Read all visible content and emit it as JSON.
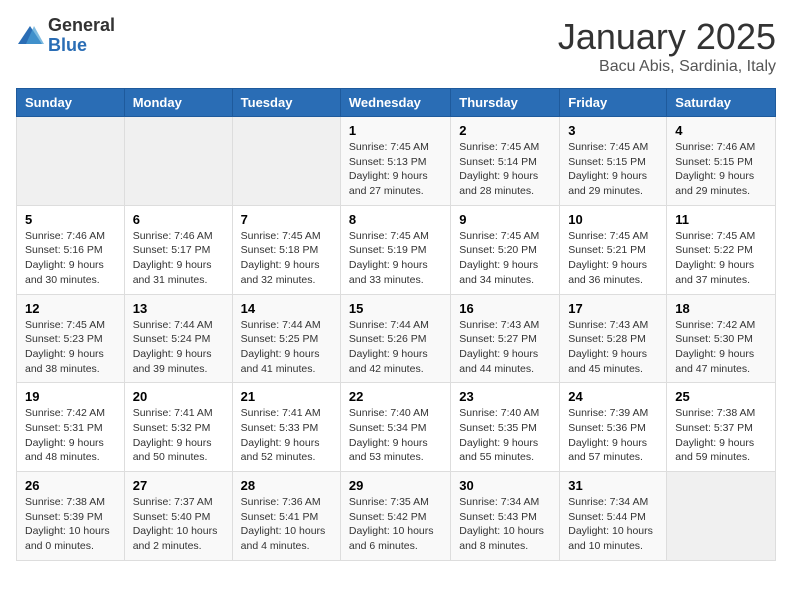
{
  "logo": {
    "general": "General",
    "blue": "Blue"
  },
  "title": "January 2025",
  "location": "Bacu Abis, Sardinia, Italy",
  "days_of_week": [
    "Sunday",
    "Monday",
    "Tuesday",
    "Wednesday",
    "Thursday",
    "Friday",
    "Saturday"
  ],
  "weeks": [
    [
      {
        "day": "",
        "detail": ""
      },
      {
        "day": "",
        "detail": ""
      },
      {
        "day": "",
        "detail": ""
      },
      {
        "day": "1",
        "detail": "Sunrise: 7:45 AM\nSunset: 5:13 PM\nDaylight: 9 hours and 27 minutes."
      },
      {
        "day": "2",
        "detail": "Sunrise: 7:45 AM\nSunset: 5:14 PM\nDaylight: 9 hours and 28 minutes."
      },
      {
        "day": "3",
        "detail": "Sunrise: 7:45 AM\nSunset: 5:15 PM\nDaylight: 9 hours and 29 minutes."
      },
      {
        "day": "4",
        "detail": "Sunrise: 7:46 AM\nSunset: 5:15 PM\nDaylight: 9 hours and 29 minutes."
      }
    ],
    [
      {
        "day": "5",
        "detail": "Sunrise: 7:46 AM\nSunset: 5:16 PM\nDaylight: 9 hours and 30 minutes."
      },
      {
        "day": "6",
        "detail": "Sunrise: 7:46 AM\nSunset: 5:17 PM\nDaylight: 9 hours and 31 minutes."
      },
      {
        "day": "7",
        "detail": "Sunrise: 7:45 AM\nSunset: 5:18 PM\nDaylight: 9 hours and 32 minutes."
      },
      {
        "day": "8",
        "detail": "Sunrise: 7:45 AM\nSunset: 5:19 PM\nDaylight: 9 hours and 33 minutes."
      },
      {
        "day": "9",
        "detail": "Sunrise: 7:45 AM\nSunset: 5:20 PM\nDaylight: 9 hours and 34 minutes."
      },
      {
        "day": "10",
        "detail": "Sunrise: 7:45 AM\nSunset: 5:21 PM\nDaylight: 9 hours and 36 minutes."
      },
      {
        "day": "11",
        "detail": "Sunrise: 7:45 AM\nSunset: 5:22 PM\nDaylight: 9 hours and 37 minutes."
      }
    ],
    [
      {
        "day": "12",
        "detail": "Sunrise: 7:45 AM\nSunset: 5:23 PM\nDaylight: 9 hours and 38 minutes."
      },
      {
        "day": "13",
        "detail": "Sunrise: 7:44 AM\nSunset: 5:24 PM\nDaylight: 9 hours and 39 minutes."
      },
      {
        "day": "14",
        "detail": "Sunrise: 7:44 AM\nSunset: 5:25 PM\nDaylight: 9 hours and 41 minutes."
      },
      {
        "day": "15",
        "detail": "Sunrise: 7:44 AM\nSunset: 5:26 PM\nDaylight: 9 hours and 42 minutes."
      },
      {
        "day": "16",
        "detail": "Sunrise: 7:43 AM\nSunset: 5:27 PM\nDaylight: 9 hours and 44 minutes."
      },
      {
        "day": "17",
        "detail": "Sunrise: 7:43 AM\nSunset: 5:28 PM\nDaylight: 9 hours and 45 minutes."
      },
      {
        "day": "18",
        "detail": "Sunrise: 7:42 AM\nSunset: 5:30 PM\nDaylight: 9 hours and 47 minutes."
      }
    ],
    [
      {
        "day": "19",
        "detail": "Sunrise: 7:42 AM\nSunset: 5:31 PM\nDaylight: 9 hours and 48 minutes."
      },
      {
        "day": "20",
        "detail": "Sunrise: 7:41 AM\nSunset: 5:32 PM\nDaylight: 9 hours and 50 minutes."
      },
      {
        "day": "21",
        "detail": "Sunrise: 7:41 AM\nSunset: 5:33 PM\nDaylight: 9 hours and 52 minutes."
      },
      {
        "day": "22",
        "detail": "Sunrise: 7:40 AM\nSunset: 5:34 PM\nDaylight: 9 hours and 53 minutes."
      },
      {
        "day": "23",
        "detail": "Sunrise: 7:40 AM\nSunset: 5:35 PM\nDaylight: 9 hours and 55 minutes."
      },
      {
        "day": "24",
        "detail": "Sunrise: 7:39 AM\nSunset: 5:36 PM\nDaylight: 9 hours and 57 minutes."
      },
      {
        "day": "25",
        "detail": "Sunrise: 7:38 AM\nSunset: 5:37 PM\nDaylight: 9 hours and 59 minutes."
      }
    ],
    [
      {
        "day": "26",
        "detail": "Sunrise: 7:38 AM\nSunset: 5:39 PM\nDaylight: 10 hours and 0 minutes."
      },
      {
        "day": "27",
        "detail": "Sunrise: 7:37 AM\nSunset: 5:40 PM\nDaylight: 10 hours and 2 minutes."
      },
      {
        "day": "28",
        "detail": "Sunrise: 7:36 AM\nSunset: 5:41 PM\nDaylight: 10 hours and 4 minutes."
      },
      {
        "day": "29",
        "detail": "Sunrise: 7:35 AM\nSunset: 5:42 PM\nDaylight: 10 hours and 6 minutes."
      },
      {
        "day": "30",
        "detail": "Sunrise: 7:34 AM\nSunset: 5:43 PM\nDaylight: 10 hours and 8 minutes."
      },
      {
        "day": "31",
        "detail": "Sunrise: 7:34 AM\nSunset: 5:44 PM\nDaylight: 10 hours and 10 minutes."
      },
      {
        "day": "",
        "detail": ""
      }
    ]
  ]
}
